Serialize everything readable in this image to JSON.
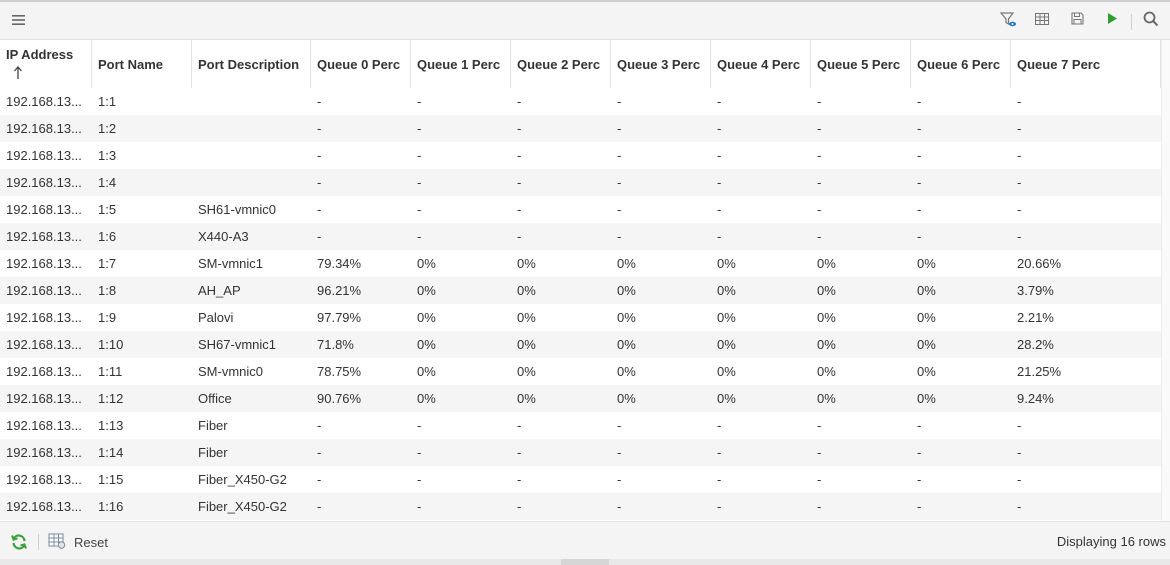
{
  "toolbar": {
    "menu_icon": "hamburger-menu-icon",
    "filter_icon": "filter-view-icon",
    "columns_icon": "table-columns-icon",
    "save_icon": "save-icon",
    "run_icon": "play-icon",
    "search_icon": "search-icon"
  },
  "table": {
    "sort_indicator": "ascending",
    "columns": [
      "IP Address",
      "Port Name",
      "Port Description",
      "Queue 0 Perc",
      "Queue 1 Perc",
      "Queue 2 Perc",
      "Queue 3 Perc",
      "Queue 4 Perc",
      "Queue 5 Perc",
      "Queue 6 Perc",
      "Queue 7 Perc"
    ],
    "rows": [
      [
        "192.168.13...",
        "1:1",
        "",
        "-",
        "-",
        "-",
        "-",
        "-",
        "-",
        "-",
        "-"
      ],
      [
        "192.168.13...",
        "1:2",
        "",
        "-",
        "-",
        "-",
        "-",
        "-",
        "-",
        "-",
        "-"
      ],
      [
        "192.168.13...",
        "1:3",
        "",
        "-",
        "-",
        "-",
        "-",
        "-",
        "-",
        "-",
        "-"
      ],
      [
        "192.168.13...",
        "1:4",
        "",
        "-",
        "-",
        "-",
        "-",
        "-",
        "-",
        "-",
        "-"
      ],
      [
        "192.168.13...",
        "1:5",
        "SH61-vmnic0",
        "-",
        "-",
        "-",
        "-",
        "-",
        "-",
        "-",
        "-"
      ],
      [
        "192.168.13...",
        "1:6",
        "X440-A3",
        "-",
        "-",
        "-",
        "-",
        "-",
        "-",
        "-",
        "-"
      ],
      [
        "192.168.13...",
        "1:7",
        "SM-vmnic1",
        "79.34%",
        "0%",
        "0%",
        "0%",
        "0%",
        "0%",
        "0%",
        "20.66%"
      ],
      [
        "192.168.13...",
        "1:8",
        "AH_AP",
        "96.21%",
        "0%",
        "0%",
        "0%",
        "0%",
        "0%",
        "0%",
        "3.79%"
      ],
      [
        "192.168.13...",
        "1:9",
        "Palovi",
        "97.79%",
        "0%",
        "0%",
        "0%",
        "0%",
        "0%",
        "0%",
        "2.21%"
      ],
      [
        "192.168.13...",
        "1:10",
        "SH67-vmnic1",
        "71.8%",
        "0%",
        "0%",
        "0%",
        "0%",
        "0%",
        "0%",
        "28.2%"
      ],
      [
        "192.168.13...",
        "1:11",
        "SM-vmnic0",
        "78.75%",
        "0%",
        "0%",
        "0%",
        "0%",
        "0%",
        "0%",
        "21.25%"
      ],
      [
        "192.168.13...",
        "1:12",
        "Office",
        "90.76%",
        "0%",
        "0%",
        "0%",
        "0%",
        "0%",
        "0%",
        "9.24%"
      ],
      [
        "192.168.13...",
        "1:13",
        "Fiber",
        "-",
        "-",
        "-",
        "-",
        "-",
        "-",
        "-",
        "-"
      ],
      [
        "192.168.13...",
        "1:14",
        "Fiber",
        "-",
        "-",
        "-",
        "-",
        "-",
        "-",
        "-",
        "-"
      ],
      [
        "192.168.13...",
        "1:15",
        "Fiber_X450-G2",
        "-",
        "-",
        "-",
        "-",
        "-",
        "-",
        "-",
        "-"
      ],
      [
        "192.168.13...",
        "1:16",
        "Fiber_X450-G2",
        "-",
        "-",
        "-",
        "-",
        "-",
        "-",
        "-",
        "-"
      ]
    ]
  },
  "footer": {
    "refresh_icon": "refresh-icon",
    "reset_icon": "reset-grid-icon",
    "reset_label": "Reset",
    "status": "Displaying 16 rows"
  },
  "colors": {
    "run_green": "#2e9e2e",
    "refresh_green": "#3aa03a",
    "filter_blue": "#1a73c8"
  }
}
